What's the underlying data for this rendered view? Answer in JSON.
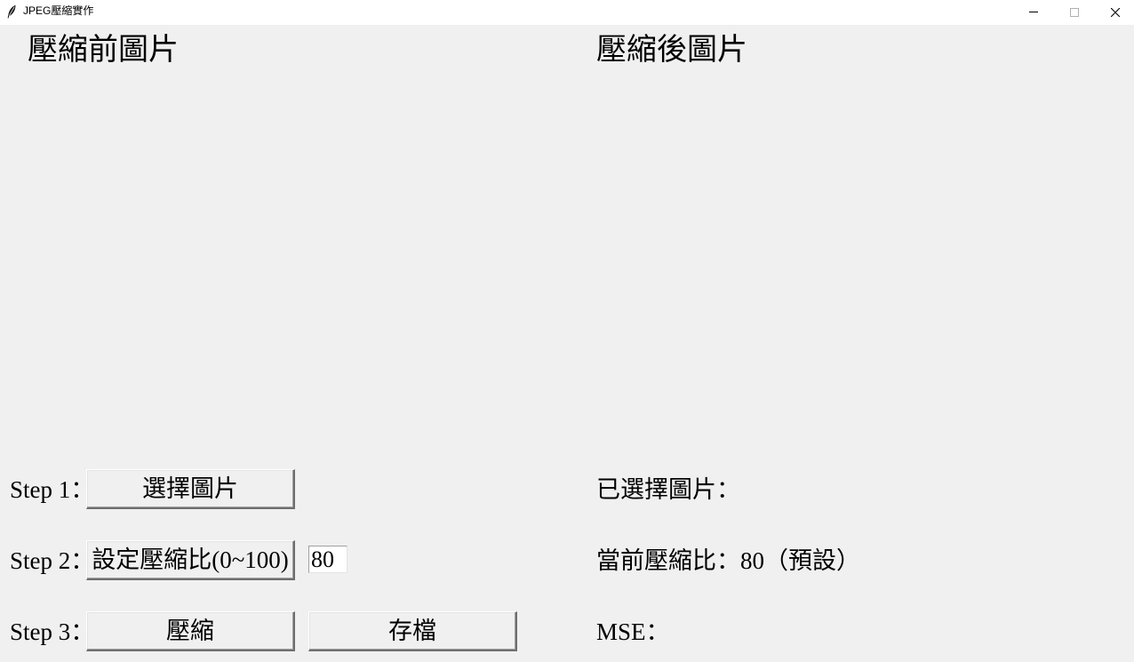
{
  "window": {
    "title": "JPEG壓縮實作"
  },
  "panels": {
    "before_title": "壓縮前圖片",
    "after_title": "壓縮後圖片"
  },
  "steps": {
    "step1_label": "Step 1：",
    "step1_button": "選擇圖片",
    "step2_label": "Step 2：",
    "step2_button": "設定壓縮比(0~100)",
    "step2_input_value": "80",
    "step3_label": "Step 3：",
    "step3_compress_button": "壓縮",
    "step3_save_button": "存檔"
  },
  "status": {
    "selected_image": "已選擇圖片：",
    "current_ratio": "當前壓縮比：80（預設）",
    "mse": "MSE："
  },
  "icons": {
    "app": "feather-icon",
    "minimize": "minimize-icon",
    "maximize": "maximize-icon",
    "close": "close-icon"
  }
}
